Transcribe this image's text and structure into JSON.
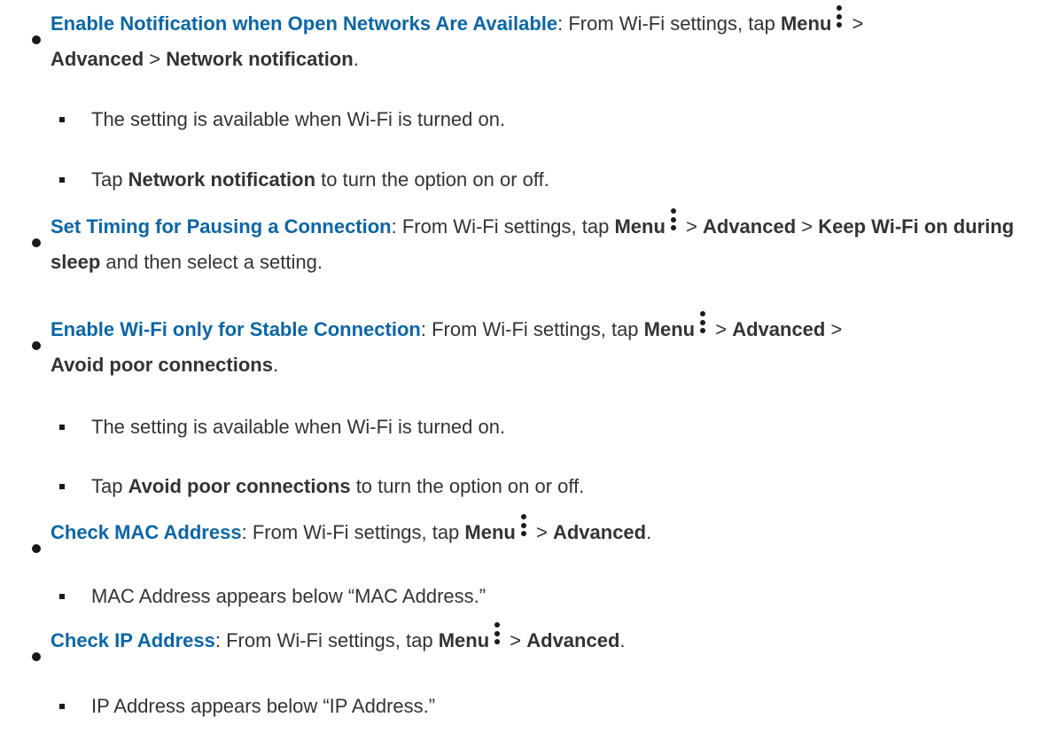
{
  "items": [
    {
      "title": "Enable Notification when Open Networks Are Available",
      "colon": ":",
      "text_before_menu": " From Wi-Fi settings, tap ",
      "menu": "Menu",
      "sep1": " > ",
      "advanced": "Advanced",
      "sep2": " > ",
      "target": "Network notification",
      "end": ".",
      "sub": [
        {
          "text": "The setting is available when Wi-Fi is turned on."
        },
        {
          "pre": "Tap ",
          "bold": "Network notification",
          "post": " to turn the option on or off."
        }
      ]
    },
    {
      "title": "Set Timing for Pausing a Connection",
      "colon": ":",
      "text_before_menu": " From Wi-Fi settings, tap ",
      "menu": "Menu",
      "sep1": " > ",
      "advanced": "Advanced",
      "sep2": " > ",
      "target": "Keep Wi-Fi on during sleep",
      "end": " and then select a setting."
    },
    {
      "title": "Enable Wi-Fi only for Stable Connection",
      "colon": ":",
      "text_before_menu": " From Wi-Fi settings, tap ",
      "menu": "Menu",
      "sep1": " > ",
      "advanced": "Advanced",
      "sep2": " > ",
      "target": "Avoid poor connections",
      "end": ".",
      "sub": [
        {
          "text": "The setting is available when Wi-Fi is turned on."
        },
        {
          "pre": "Tap ",
          "bold": "Avoid poor connections",
          "post": " to turn the option on or off."
        }
      ]
    },
    {
      "title": "Check MAC Address",
      "colon": ":",
      "text_before_menu": " From Wi-Fi settings, tap ",
      "menu": "Menu",
      "sep1": " > ",
      "advanced": "Advanced",
      "end": ".",
      "sub": [
        {
          "text": "MAC Address appears below “MAC Address.”"
        }
      ]
    },
    {
      "title": "Check IP Address",
      "colon": ":",
      "text_before_menu": " From Wi-Fi settings, tap ",
      "menu": "Menu",
      "sep1": " > ",
      "advanced": "Advanced",
      "end": ".",
      "sub": [
        {
          "text": "IP Address appears below “IP Address.”"
        }
      ]
    }
  ],
  "icons": {
    "menu": "kebab-menu-icon"
  },
  "colors": {
    "title": "#0b66a6",
    "text": "#333333"
  }
}
